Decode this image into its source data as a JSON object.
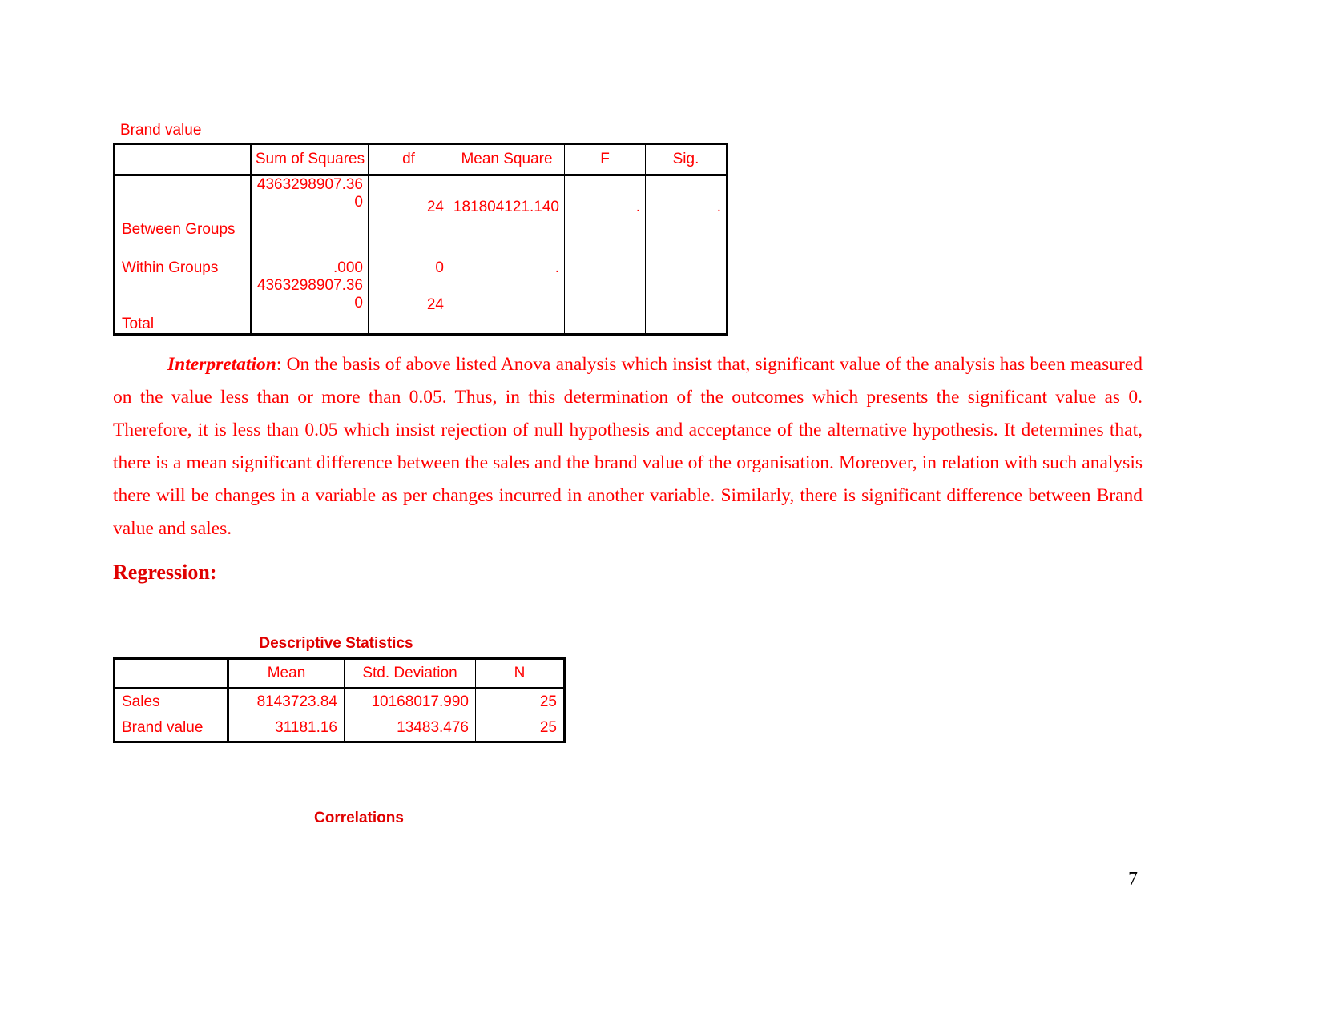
{
  "document": {
    "page_number": "7"
  },
  "anova": {
    "caption": "Brand value",
    "columns": [
      "",
      "Sum of Squares",
      "df",
      "Mean Square",
      "F",
      "Sig."
    ],
    "rows": [
      {
        "label": "Between Groups",
        "sum_of_squares": "4363298907.360",
        "df": "24",
        "mean_square": "181804121.140",
        "f": ".",
        "sig": "."
      },
      {
        "label": "Within Groups",
        "sum_of_squares": ".000",
        "df": "0",
        "mean_square": ".",
        "f": "",
        "sig": ""
      },
      {
        "label": "Total",
        "sum_of_squares": "4363298907.360",
        "df": "24",
        "mean_square": "",
        "f": "",
        "sig": ""
      }
    ]
  },
  "interpretation": {
    "lead": "Interpretation",
    "body": ": On the basis of above listed Anova analysis which insist that, significant value of the analysis has been measured on the value less than or more than 0.05. Thus, in this determination of the outcomes which presents the significant value as 0. Therefore, it is less than 0.05 which insist rejection of null hypothesis and acceptance of the alternative hypothesis. It determines that, there is a mean significant difference between the sales and the brand value of the organisation. Moreover, in relation with such analysis there will be changes in a variable as per changes incurred in another variable. Similarly, there is significant difference between Brand value and sales."
  },
  "regression": {
    "heading": "Regression",
    "heading_colon": ":"
  },
  "descriptive_statistics": {
    "title": "Descriptive Statistics",
    "columns": [
      "",
      "Mean",
      "Std. Deviation",
      "N"
    ],
    "rows": [
      {
        "label": "Sales",
        "mean": "8143723.84",
        "std_deviation": "10168017.990",
        "n": "25"
      },
      {
        "label": "Brand value",
        "mean": "31181.16",
        "std_deviation": "13483.476",
        "n": "25"
      }
    ]
  },
  "correlations": {
    "title": "Correlations"
  },
  "colors": {
    "text_red": "#ff0000",
    "heading_red": "#e00000",
    "rule_black": "#000000",
    "page_background": "#ffffff"
  }
}
